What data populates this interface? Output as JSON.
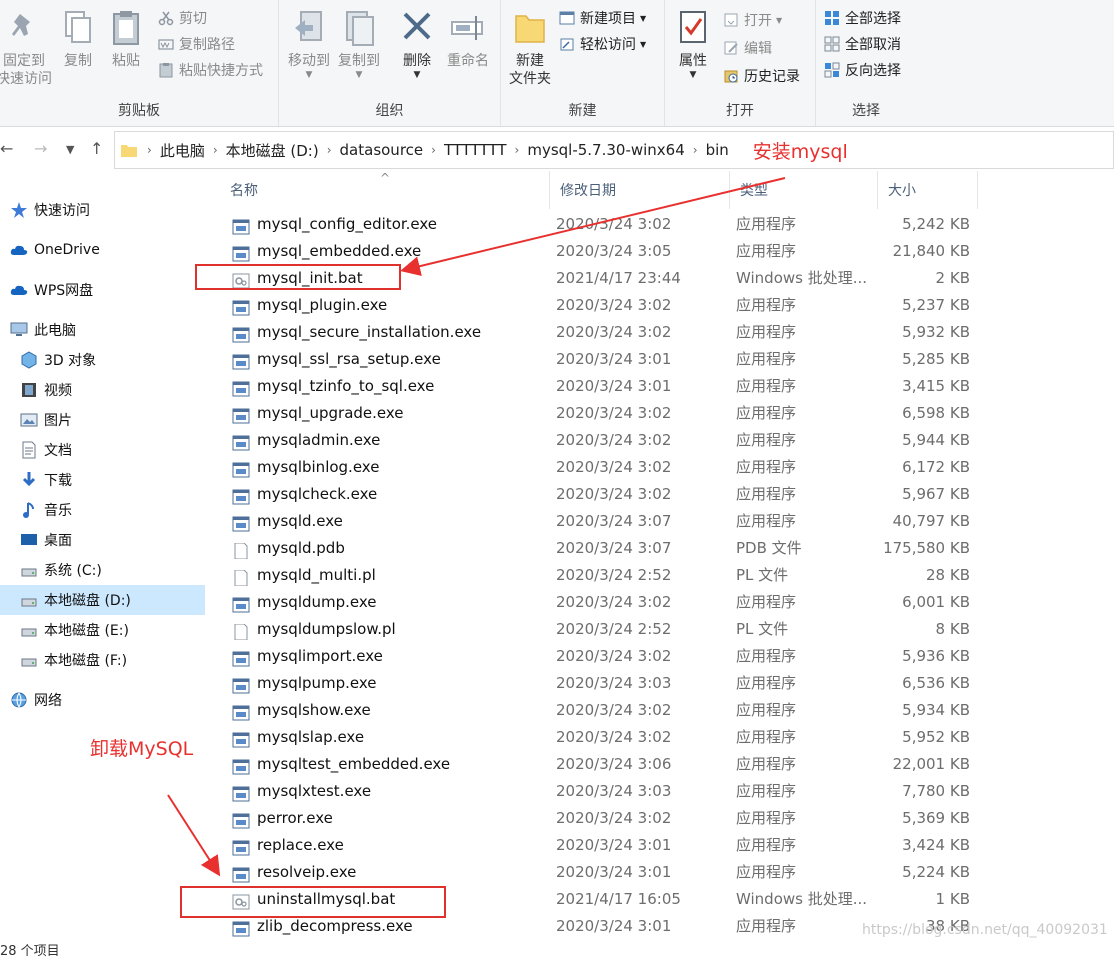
{
  "ribbon": {
    "clipboard": {
      "pin_label_1": "固定到",
      "pin_label_2": "快速访问",
      "copy_label": "复制",
      "paste_label": "粘贴",
      "cut_label": "剪切",
      "copy_path_label": "复制路径",
      "paste_shortcut_label": "粘贴快捷方式",
      "group_label": "剪贴板"
    },
    "organize": {
      "move_to_label": "移动到",
      "copy_to_label": "复制到",
      "delete_label": "删除",
      "rename_label": "重命名",
      "group_label": "组织"
    },
    "new": {
      "new_folder_label_1": "新建",
      "new_folder_label_2": "文件夹",
      "new_item_label": "新建项目",
      "easy_access_label": "轻松访问",
      "group_label": "新建"
    },
    "open": {
      "properties_label": "属性",
      "open_label": "打开",
      "edit_label": "编辑",
      "history_label": "历史记录",
      "group_label": "打开"
    },
    "select": {
      "select_all_label": "全部选择",
      "select_none_label": "全部取消",
      "invert_label": "反向选择",
      "group_label": "选择"
    }
  },
  "address_bar": {
    "crumbs": [
      "此电脑",
      "本地磁盘 (D:)",
      "datasource",
      "TTTTTTT",
      "mysql-5.7.30-winx64",
      "bin"
    ]
  },
  "sidebar": {
    "items": [
      {
        "label": "快速访问",
        "icon": "star-icon"
      },
      {
        "label": "OneDrive",
        "icon": "cloud-icon"
      },
      {
        "label": "WPS网盘",
        "icon": "cloud-icon"
      },
      {
        "label": "此电脑",
        "icon": "computer-icon"
      },
      {
        "label": "3D 对象",
        "icon": "cube-icon"
      },
      {
        "label": "视频",
        "icon": "film-icon"
      },
      {
        "label": "图片",
        "icon": "picture-icon"
      },
      {
        "label": "文档",
        "icon": "document-icon"
      },
      {
        "label": "下载",
        "icon": "download-icon"
      },
      {
        "label": "音乐",
        "icon": "music-icon"
      },
      {
        "label": "桌面",
        "icon": "desktop-icon"
      },
      {
        "label": "系统 (C:)",
        "icon": "drive-icon"
      },
      {
        "label": "本地磁盘 (D:)",
        "icon": "drive-icon"
      },
      {
        "label": "本地磁盘 (E:)",
        "icon": "drive-icon"
      },
      {
        "label": "本地磁盘 (F:)",
        "icon": "drive-icon"
      },
      {
        "label": "网络",
        "icon": "network-icon"
      }
    ]
  },
  "columns": {
    "name": "名称",
    "date": "修改日期",
    "type": "类型",
    "size": "大小"
  },
  "files": [
    {
      "name": "mysql_config_editor.exe",
      "date": "2020/3/24 3:02",
      "type": "应用程序",
      "size": "5,242 KB",
      "kind": "exe"
    },
    {
      "name": "mysql_embedded.exe",
      "date": "2020/3/24 3:05",
      "type": "应用程序",
      "size": "21,840 KB",
      "kind": "exe"
    },
    {
      "name": "mysql_init.bat",
      "date": "2021/4/17 23:44",
      "type": "Windows 批处理...",
      "size": "2 KB",
      "kind": "bat"
    },
    {
      "name": "mysql_plugin.exe",
      "date": "2020/3/24 3:02",
      "type": "应用程序",
      "size": "5,237 KB",
      "kind": "exe"
    },
    {
      "name": "mysql_secure_installation.exe",
      "date": "2020/3/24 3:02",
      "type": "应用程序",
      "size": "5,932 KB",
      "kind": "exe"
    },
    {
      "name": "mysql_ssl_rsa_setup.exe",
      "date": "2020/3/24 3:01",
      "type": "应用程序",
      "size": "5,285 KB",
      "kind": "exe"
    },
    {
      "name": "mysql_tzinfo_to_sql.exe",
      "date": "2020/3/24 3:01",
      "type": "应用程序",
      "size": "3,415 KB",
      "kind": "exe"
    },
    {
      "name": "mysql_upgrade.exe",
      "date": "2020/3/24 3:02",
      "type": "应用程序",
      "size": "6,598 KB",
      "kind": "exe"
    },
    {
      "name": "mysqladmin.exe",
      "date": "2020/3/24 3:02",
      "type": "应用程序",
      "size": "5,944 KB",
      "kind": "exe"
    },
    {
      "name": "mysqlbinlog.exe",
      "date": "2020/3/24 3:02",
      "type": "应用程序",
      "size": "6,172 KB",
      "kind": "exe"
    },
    {
      "name": "mysqlcheck.exe",
      "date": "2020/3/24 3:02",
      "type": "应用程序",
      "size": "5,967 KB",
      "kind": "exe"
    },
    {
      "name": "mysqld.exe",
      "date": "2020/3/24 3:07",
      "type": "应用程序",
      "size": "40,797 KB",
      "kind": "exe"
    },
    {
      "name": "mysqld.pdb",
      "date": "2020/3/24 3:07",
      "type": "PDB 文件",
      "size": "175,580 KB",
      "kind": "doc"
    },
    {
      "name": "mysqld_multi.pl",
      "date": "2020/3/24 2:52",
      "type": "PL 文件",
      "size": "28 KB",
      "kind": "doc"
    },
    {
      "name": "mysqldump.exe",
      "date": "2020/3/24 3:02",
      "type": "应用程序",
      "size": "6,001 KB",
      "kind": "exe"
    },
    {
      "name": "mysqldumpslow.pl",
      "date": "2020/3/24 2:52",
      "type": "PL 文件",
      "size": "8 KB",
      "kind": "doc"
    },
    {
      "name": "mysqlimport.exe",
      "date": "2020/3/24 3:02",
      "type": "应用程序",
      "size": "5,936 KB",
      "kind": "exe"
    },
    {
      "name": "mysqlpump.exe",
      "date": "2020/3/24 3:03",
      "type": "应用程序",
      "size": "6,536 KB",
      "kind": "exe"
    },
    {
      "name": "mysqlshow.exe",
      "date": "2020/3/24 3:02",
      "type": "应用程序",
      "size": "5,934 KB",
      "kind": "exe"
    },
    {
      "name": "mysqlslap.exe",
      "date": "2020/3/24 3:02",
      "type": "应用程序",
      "size": "5,952 KB",
      "kind": "exe"
    },
    {
      "name": "mysqltest_embedded.exe",
      "date": "2020/3/24 3:06",
      "type": "应用程序",
      "size": "22,001 KB",
      "kind": "exe"
    },
    {
      "name": "mysqlxtest.exe",
      "date": "2020/3/24 3:03",
      "type": "应用程序",
      "size": "7,780 KB",
      "kind": "exe"
    },
    {
      "name": "perror.exe",
      "date": "2020/3/24 3:02",
      "type": "应用程序",
      "size": "5,369 KB",
      "kind": "exe"
    },
    {
      "name": "replace.exe",
      "date": "2020/3/24 3:01",
      "type": "应用程序",
      "size": "3,424 KB",
      "kind": "exe"
    },
    {
      "name": "resolveip.exe",
      "date": "2020/3/24 3:01",
      "type": "应用程序",
      "size": "5,224 KB",
      "kind": "exe"
    },
    {
      "name": "uninstallmysql.bat",
      "date": "2021/4/17 16:05",
      "type": "Windows 批处理...",
      "size": "1 KB",
      "kind": "bat"
    },
    {
      "name": "zlib_decompress.exe",
      "date": "2020/3/24 3:01",
      "type": "应用程序",
      "size": "38 KB",
      "kind": "exe"
    }
  ],
  "annotations": {
    "install": "安装mysql",
    "uninstall": "卸载MySQL",
    "color": "#e8312f"
  },
  "status": {
    "count": "28 个项目"
  },
  "watermark": "https://blog.csdn.net/qq_40092031"
}
